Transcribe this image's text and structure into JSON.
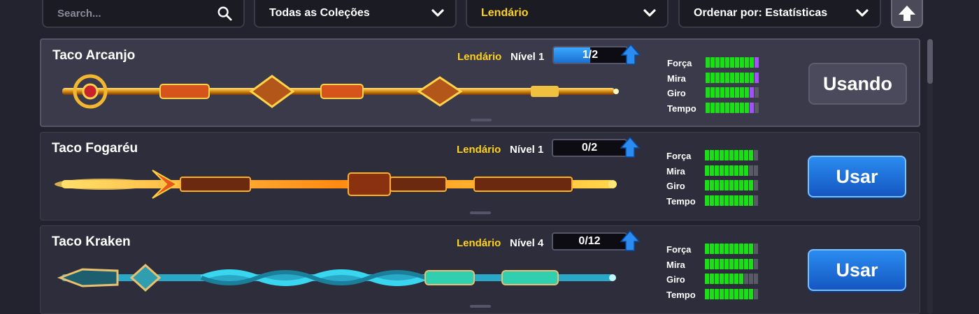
{
  "topbar": {
    "search_placeholder": "Search...",
    "collection_filter": "Todas as Coleções",
    "rarity_filter": "Lendário",
    "sort_label": "Ordenar por: Estatísticas"
  },
  "colors": {
    "legendary": "#ffd21e",
    "stat_green": "#17e013",
    "stat_purple": "#a450ff",
    "stat_empty": "#5a5a66",
    "button_blue": "#1c6fe0"
  },
  "stat_labels": [
    "Força",
    "Mira",
    "Giro",
    "Tempo"
  ],
  "cues": [
    {
      "name": "Taco Arcanjo",
      "rarity": "Lendário",
      "level": "Nível 1",
      "progress_text": "1/2",
      "progress_fraction": 0.5,
      "stats": {
        "Força": [
          10,
          1
        ],
        "Mira": [
          10,
          1
        ],
        "Giro": [
          9,
          1
        ],
        "Tempo": [
          9,
          1
        ]
      },
      "button": "Usando",
      "selected": true
    },
    {
      "name": "Taco Fogaréu",
      "rarity": "Lendário",
      "level": "Nível 1",
      "progress_text": "0/2",
      "progress_fraction": 0,
      "stats": {
        "Força": [
          10,
          0
        ],
        "Mira": [
          9,
          0
        ],
        "Giro": [
          10,
          0
        ],
        "Tempo": [
          10,
          0
        ]
      },
      "button": "Usar",
      "selected": false
    },
    {
      "name": "Taco Kraken",
      "rarity": "Lendário",
      "level": "Nível 4",
      "progress_text": "0/12",
      "progress_fraction": 0,
      "stats": {
        "Força": [
          10,
          0
        ],
        "Mira": [
          10,
          0
        ],
        "Giro": [
          8,
          0
        ],
        "Tempo": [
          10,
          0
        ]
      },
      "button": "Usar",
      "selected": false
    }
  ]
}
